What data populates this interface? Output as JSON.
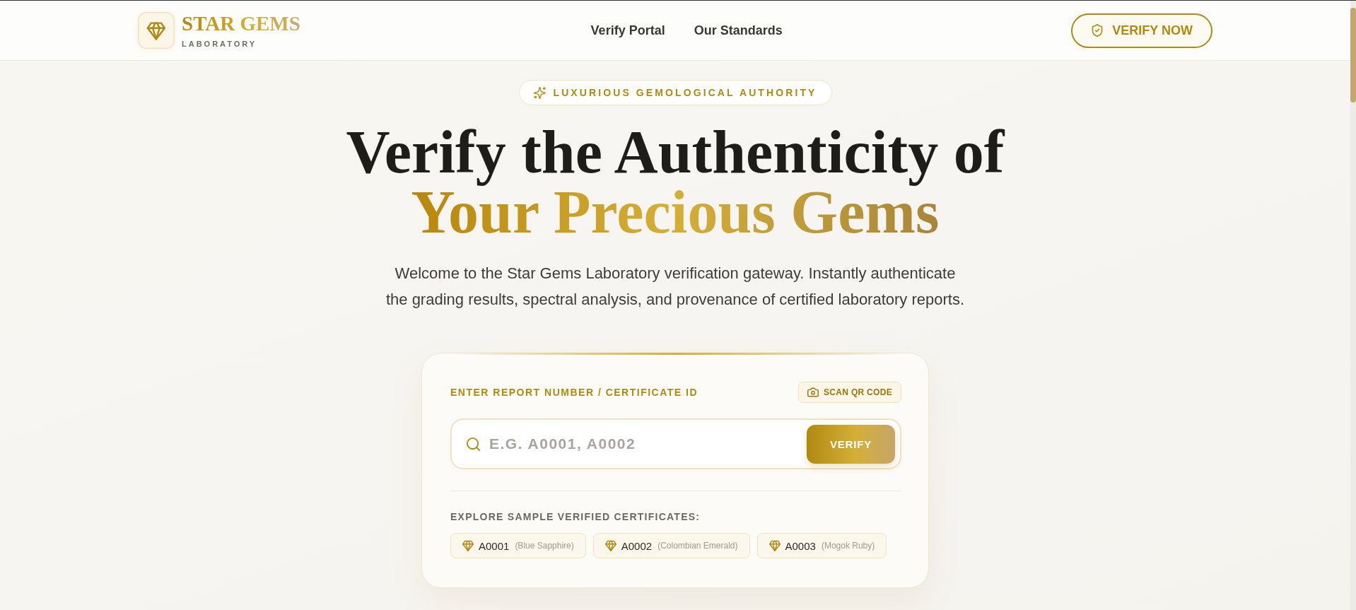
{
  "header": {
    "logo": {
      "title": "STAR GEMS",
      "subtitle": "LABORATORY"
    },
    "nav": [
      {
        "label": "Verify Portal"
      },
      {
        "label": "Our Standards"
      }
    ],
    "cta_button": {
      "label": "VERIFY NOW"
    }
  },
  "hero": {
    "badge": "LUXURIOUS GEMOLOGICAL AUTHORITY",
    "title": "Verify the Authenticity of",
    "title_highlight": "Your Precious Gems",
    "intro": "Welcome to the Star Gems Laboratory verification gateway. Instantly authenticate the grading results, spectral analysis, and provenance of certified laboratory reports."
  },
  "verify_card": {
    "label": "ENTER REPORT NUMBER / CERTIFICATE ID",
    "scan_button": "SCAN QR CODE",
    "search": {
      "placeholder": "E.G. A0001, A0002"
    },
    "submit_button": "VERIFY",
    "samples_title": "EXPLORE SAMPLE VERIFIED CERTIFICATES:",
    "samples": [
      {
        "id": "A0001",
        "name": "(Blue Sapphire)"
      },
      {
        "id": "A0002",
        "name": "(Colombian Emerald)"
      },
      {
        "id": "A0003",
        "name": "(Mogok Ruby)"
      }
    ]
  }
}
